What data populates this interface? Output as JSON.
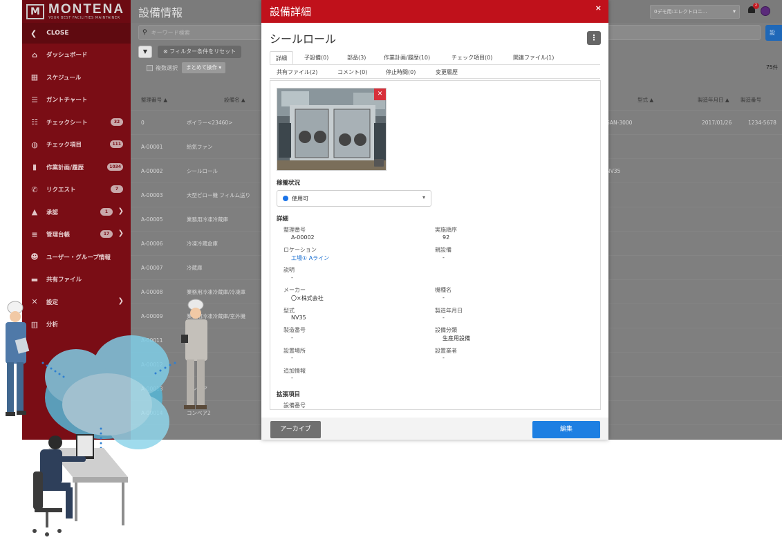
{
  "sidebar": {
    "brand": "MONTENA",
    "tagline": "YOUR BEST FACILITIES MAINTAINER",
    "close_label": "CLOSE",
    "items": [
      {
        "label": "ダッシュボード",
        "icon": "home-icon"
      },
      {
        "label": "スケジュール",
        "icon": "calendar-icon"
      },
      {
        "label": "ガントチャート",
        "icon": "gantt-icon"
      },
      {
        "label": "チェックシート",
        "icon": "checklist-icon",
        "badge": "32"
      },
      {
        "label": "チェック項目",
        "icon": "check-item-icon",
        "badge": "111"
      },
      {
        "label": "作業計画/履歴",
        "icon": "clipboard-icon",
        "badge": "1034"
      },
      {
        "label": "リクエスト",
        "icon": "phone-icon",
        "badge": "7"
      },
      {
        "label": "承認",
        "icon": "thumbs-up-icon",
        "badge": "1"
      },
      {
        "label": "管理台帳",
        "icon": "database-icon",
        "badge": "17"
      },
      {
        "label": "ユーザー・グループ情報",
        "icon": "users-icon"
      },
      {
        "label": "共有ファイル",
        "icon": "folder-icon"
      },
      {
        "label": "設定",
        "icon": "wrench-icon"
      },
      {
        "label": "分析",
        "icon": "bar-chart-icon"
      }
    ]
  },
  "header": {
    "title": "設備情報",
    "demo_select": "0デモ用:エレクトロニ…",
    "bell_badge": "2"
  },
  "toolbar": {
    "search_placeholder": "キーワード検索",
    "search_button": "設",
    "reset_filter": "フィルター条件をリセット",
    "multi_select": "複数選択",
    "bulk_action": "まとめて操作 ▾",
    "count": "75件"
  },
  "table": {
    "headers": [
      "整理番号 ▲",
      "設備名 ▲",
      "型式 ▲",
      "製造年月日 ▲",
      "製造番号"
    ],
    "rows": [
      [
        "0",
        "ボイラー<23460>",
        "SAN-3000",
        "2017/01/26",
        "1234-5678"
      ],
      [
        "A-00001",
        "給気ファン",
        "",
        "",
        ""
      ],
      [
        "A-00002",
        "シールロール",
        "NV35",
        "",
        ""
      ],
      [
        "A-00003",
        "大型ピロー機 フィルム送り",
        "",
        "",
        ""
      ],
      [
        "A-00005",
        "業務用冷凍冷蔵庫",
        "",
        "",
        ""
      ],
      [
        "A-00006",
        "冷凍冷蔵倉庫",
        "",
        "",
        ""
      ],
      [
        "A-00007",
        "冷蔵庫",
        "",
        "",
        ""
      ],
      [
        "A-00008",
        "業務用冷凍冷蔵庫/冷凍庫",
        "",
        "",
        ""
      ],
      [
        "A-00009",
        "業務用冷凍冷蔵庫/室外機",
        "",
        "",
        ""
      ],
      [
        "A-00011",
        "",
        "",
        "",
        ""
      ],
      [
        "A-00012",
        "",
        "",
        "",
        ""
      ],
      [
        "A-00013",
        "コンベア",
        "",
        "",
        ""
      ],
      [
        "A-00014",
        "コンベア2",
        "",
        "",
        ""
      ]
    ]
  },
  "modal": {
    "title": "設備詳細",
    "close": "×",
    "equipment_name": "シールロール",
    "kebab": "⋮",
    "tabs_row1": [
      "詳細",
      "子設備(0)",
      "部品(3)",
      "作業計画/履歴(10)",
      "チェック項目(0)",
      "関連ファイル(1)"
    ],
    "tabs_row2": [
      "共有ファイル(2)",
      "コメント(0)",
      "停止時間(0)",
      "変更履歴"
    ],
    "status_heading": "稼働状況",
    "status_value": "使用可",
    "status_color": "#1a73e8",
    "details_heading": "詳細",
    "fields_left": [
      {
        "label": "整理番号",
        "value": "A-00002"
      },
      {
        "label": "ロケーション",
        "value": "工場① Aライン"
      },
      {
        "label": "説明",
        "value": "-"
      },
      {
        "label": "メーカー",
        "value": "〇×株式会社"
      },
      {
        "label": "型式",
        "value": "NV35"
      },
      {
        "label": "製造番号",
        "value": "-"
      },
      {
        "label": "設置場所",
        "value": "-"
      },
      {
        "label": "追加情報",
        "value": "-"
      }
    ],
    "fields_right": [
      {
        "label": "実施順序",
        "value": "92"
      },
      {
        "label": "親設備",
        "value": "-"
      },
      {
        "label": "機種名",
        "value": "-"
      },
      {
        "label": "製造年月日",
        "value": "-"
      },
      {
        "label": "設備分類",
        "value": "生産用設備"
      },
      {
        "label": "設置業者",
        "value": "-"
      }
    ],
    "extended_heading": "拡張項目",
    "extended_first_label": "設備番号",
    "archive_button": "アーカイブ",
    "edit_button": "編集"
  },
  "colors": {
    "brand_red": "#c0111b",
    "sidebar_red": "#7a0d15",
    "primary_blue": "#1d7fe2"
  }
}
